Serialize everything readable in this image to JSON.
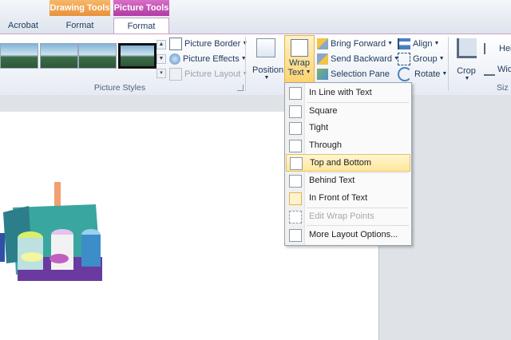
{
  "context_tabs": {
    "drawing_tools": "Drawing Tools",
    "picture_tools": "Picture Tools"
  },
  "tabs": [
    "Acrobat",
    "Format",
    "Format"
  ],
  "picture_styles": {
    "group_label": "Picture Styles",
    "picture_border": "Picture Border",
    "picture_effects": "Picture Effects",
    "picture_layout": "Picture Layout"
  },
  "arrange": {
    "position": "Position",
    "wrap_text_line1": "Wrap",
    "wrap_text_line2": "Text",
    "bring_forward": "Bring Forward",
    "send_backward": "Send Backward",
    "selection_pane": "Selection Pane",
    "align": "Align",
    "group": "Group",
    "rotate": "Rotate"
  },
  "size": {
    "crop": "Crop",
    "height_partial": "Heig",
    "width_partial": "Wid",
    "group_label_partial": "Siz"
  },
  "wrap_menu": {
    "items": [
      "In Line with Text",
      "Square",
      "Tight",
      "Through",
      "Top and Bottom",
      "Behind Text",
      "In Front of Text",
      "Edit Wrap Points",
      "More Layout Options..."
    ],
    "highlighted": "Top and Bottom"
  },
  "colors": {
    "drawing_tools_accent": "#e8913a",
    "picture_tools_accent": "#b13aa4",
    "highlight": "#ffe79a"
  }
}
